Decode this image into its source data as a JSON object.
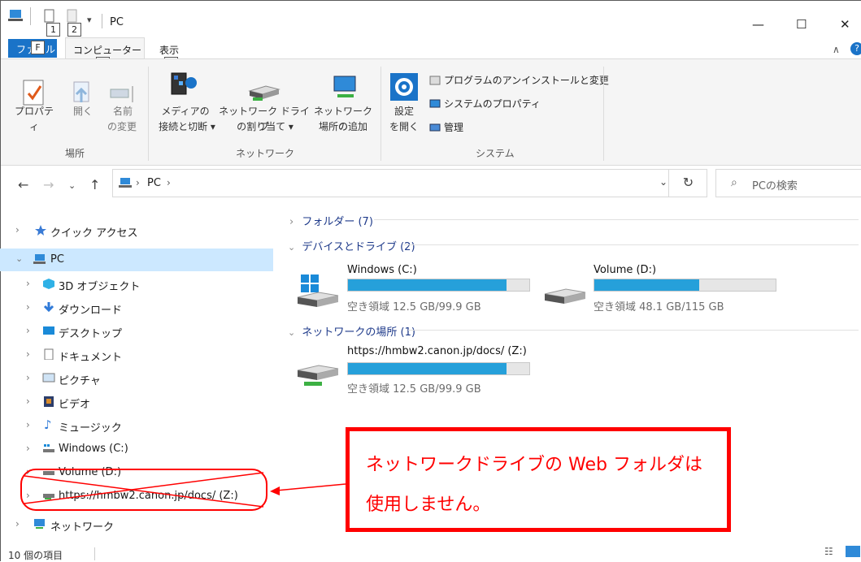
{
  "window": {
    "title": "PC",
    "quick_access_nums": [
      "1",
      "2"
    ]
  },
  "ribbon": {
    "tabs": {
      "file": "ファイル",
      "computer": "コンピューター",
      "view": "表示"
    },
    "keytips": {
      "file": "F",
      "computer": "C",
      "view": "V"
    },
    "location": {
      "properties": "プロパティ",
      "open": "開く",
      "rename_1": "名前",
      "rename_2": "の変更",
      "group": "場所"
    },
    "network": {
      "media_1": "メディアの",
      "media_2": "接続と切断 ▾",
      "map_1": "ネットワーク ドライブ",
      "map_2": "の割り当て ▾",
      "add_1": "ネットワークの",
      "add_2": "場所の追加",
      "group": "ネットワーク"
    },
    "system": {
      "settings_1": "設定",
      "settings_2": "を開く",
      "uninstall": "プログラムのアンインストールと変更",
      "sys_props": "システムのプロパティ",
      "manage": "管理",
      "group": "システム"
    }
  },
  "address": {
    "path_pc": "PC",
    "search_placeholder": "PCの検索"
  },
  "nav": {
    "quick_access": "クイック アクセス",
    "pc": "PC",
    "items": [
      "3D オブジェクト",
      "ダウンロード",
      "デスクトップ",
      "ドキュメント",
      "ピクチャ",
      "ビデオ",
      "ミュージック",
      "Windows (C:)",
      "Volume (D:)",
      "https://hmbw2.canon.jp/docs/ (Z:)"
    ],
    "network": "ネットワーク"
  },
  "content": {
    "folders": "フォルダー (7)",
    "devices": "デバイスとドライブ (2)",
    "netloc": "ネットワークの場所 (1)",
    "drives": [
      {
        "name": "Windows (C:)",
        "free": "空き領域 12.5 GB/99.9 GB",
        "used_fraction": 0.875
      },
      {
        "name": "Volume (D:)",
        "free": "空き領域 48.1 GB/115 GB",
        "used_fraction": 0.58
      },
      {
        "name": "https://hmbw2.canon.jp/docs/ (Z:)",
        "free": "空き領域 12.5 GB/99.9 GB",
        "used_fraction": 0.875
      }
    ]
  },
  "status": {
    "count": "10 個の項目"
  },
  "annotation": {
    "line1": "ネットワークドライブの Web フォルダは",
    "line2": "使用しません。"
  }
}
